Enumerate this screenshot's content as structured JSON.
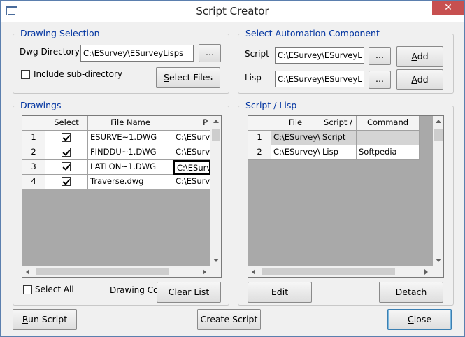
{
  "window": {
    "title": "Script Creator",
    "close_label": "✕"
  },
  "drawing_selection": {
    "title": "Drawing Selection",
    "dwg_directory_label": "Dwg Directory",
    "dwg_directory_value": "C:\\ESurvey\\ESurveyLisps",
    "browse_label": "...",
    "include_subdir_label": "Include sub-directory",
    "include_subdir_checked": false,
    "select_files_label_prefix": "",
    "select_files_label_u": "S",
    "select_files_label_rest": "elect Files"
  },
  "automation": {
    "title": "Select Automation Component",
    "script_label": "Script",
    "script_value": "C:\\ESurvey\\ESurveyL",
    "lisp_label": "Lisp",
    "lisp_value": "C:\\ESurvey\\ESurveyL",
    "browse_label": "...",
    "add_label_u": "A",
    "add_label_rest": "dd"
  },
  "drawings": {
    "title": "Drawings",
    "columns": [
      "Select",
      "File Name",
      "P"
    ],
    "rows": [
      {
        "num": "1",
        "checked": true,
        "file": "ESURVE~1.DWG",
        "path": "C:\\ESurv"
      },
      {
        "num": "2",
        "checked": true,
        "file": "FINDDU~1.DWG",
        "path": "C:\\ESurv"
      },
      {
        "num": "3",
        "checked": true,
        "file": "LATLON~1.DWG",
        "path": "C:\\ESurv"
      },
      {
        "num": "4",
        "checked": true,
        "file": "Traverse.dwg",
        "path": "C:\\ESurv"
      }
    ],
    "select_all_label": "Select All",
    "drawing_count_label": "Drawing Co",
    "clear_list_u": "C",
    "clear_list_rest": "lear List"
  },
  "script_lisp": {
    "title": "Script / Lisp",
    "columns": [
      "File",
      "Script /",
      "Command"
    ],
    "rows": [
      {
        "num": "1",
        "file": "C:\\ESurvey\\",
        "type": "Script",
        "command": ""
      },
      {
        "num": "2",
        "file": "C:\\ESurvey\\",
        "type": "Lisp",
        "command": "Softpedia"
      }
    ],
    "edit_label_u": "E",
    "edit_label_rest": "dit",
    "detach_label_pre": "De",
    "detach_label_u": "t",
    "detach_label_rest": "ach"
  },
  "footer": {
    "run_script_u": "R",
    "run_script_rest": "un Script",
    "create_script_label": "Create Script",
    "close_u": "C",
    "close_rest": "lose"
  }
}
